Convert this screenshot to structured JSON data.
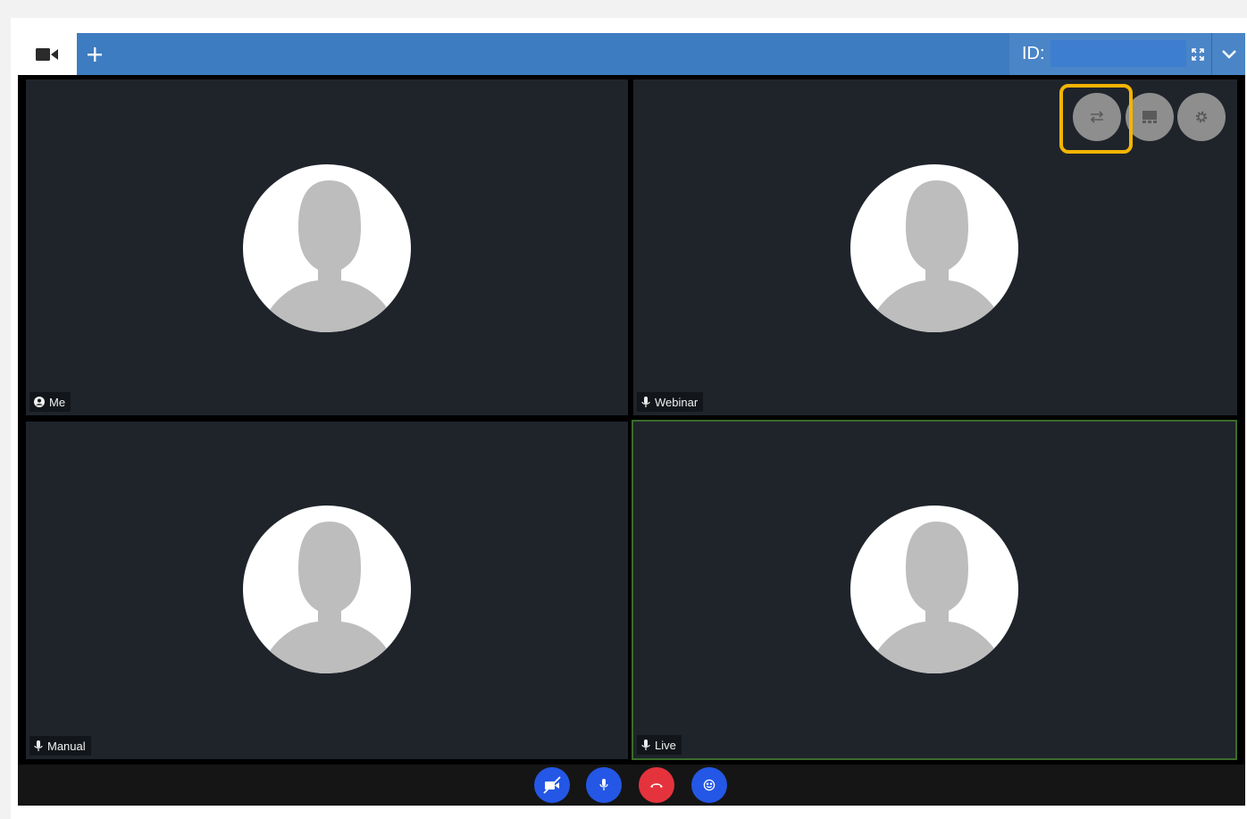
{
  "topbar": {
    "camera_tab_icon": "video-camera-icon",
    "add_tab_icon": "plus-icon",
    "id_label": "ID:",
    "id_value": "",
    "fullscreen_icon": "fullscreen-icon",
    "menu_icon": "chevron-down-icon",
    "colors": {
      "bar": "#3d7cc1",
      "tab_active": "#ffffff"
    }
  },
  "overlay_controls": [
    {
      "icon": "swap-arrows-icon",
      "highlighted": true
    },
    {
      "icon": "layout-grid-icon"
    },
    {
      "icon": "settings-gear-icon"
    }
  ],
  "participants": [
    {
      "name": "Me",
      "icon": "user-circle-icon"
    },
    {
      "name": "Webinar",
      "icon": "microphone-icon"
    },
    {
      "name": "Manual",
      "icon": "microphone-icon"
    },
    {
      "name": "Live",
      "icon": "microphone-icon",
      "active": true
    }
  ],
  "call_controls": [
    {
      "icon": "video-off-icon",
      "color": "#2457e5"
    },
    {
      "icon": "microphone-icon",
      "color": "#2457e5"
    },
    {
      "icon": "hang-up-icon",
      "color": "#e5333d"
    },
    {
      "icon": "emoji-icon",
      "color": "#2457e5"
    }
  ],
  "colors": {
    "highlight": "#f4b400",
    "active_tile_border": "#3b6b2a",
    "tile_bg": "#1f242b"
  }
}
